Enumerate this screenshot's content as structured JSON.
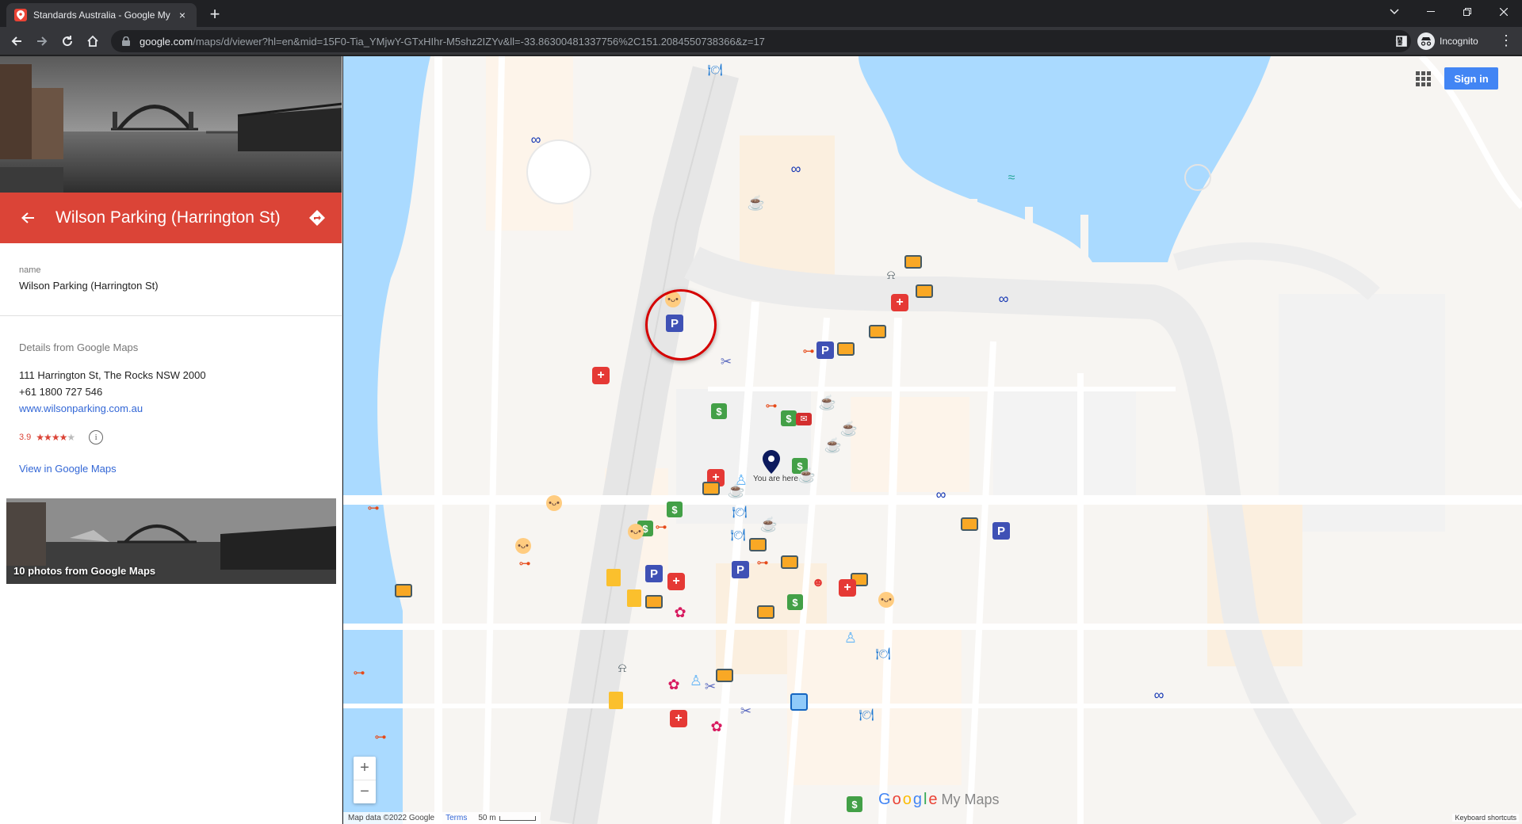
{
  "browser": {
    "tab_title": "Standards Australia - Google My",
    "tab_close": "×",
    "new_tab": "+",
    "url_host": "google.com",
    "url_path": "/maps/d/viewer?hl=en&mid=15F0-Tia_YMjwY-GTxHIhr-M5shz2IZYv&ll=-33.86300481337756%2C151.2084550738366&z=17",
    "profile_label": "Incognito",
    "menu": "⋮"
  },
  "panel": {
    "title": "Wilson Parking (Harrington St)",
    "name_key": "name",
    "name_value": "Wilson Parking (Harrington St)",
    "details_heading": "Details from Google Maps",
    "address": "111 Harrington St, The Rocks NSW 2000",
    "phone": "+61 1800 727 546",
    "website": "www.wilsonparking.com.au",
    "rating": "3.9",
    "rating_value": 3.9,
    "rating_max": 5,
    "view_link": "View in Google Maps",
    "photos_label": "10 photos from Google Maps",
    "accent_color": "#db4437"
  },
  "map": {
    "signin_label": "Sign in",
    "you_are_here": "You are here",
    "zoom_in": "+",
    "zoom_out": "−",
    "logo_google": [
      "G",
      "o",
      "o",
      "g",
      "l",
      "e"
    ],
    "logo_suffix": "My Maps",
    "attribution": "Map data ©2022 Google",
    "terms": "Terms",
    "scale_label": "50 m",
    "keyboard_shortcuts": "Keyboard shortcuts",
    "selected_marker": "P"
  },
  "icons": {
    "binoculars": "∞",
    "restaurant": "🍽",
    "gym": "⊶",
    "cafe": "☕",
    "medical": "+",
    "parking": "P",
    "cash": "$",
    "flower": "✿",
    "tooth": "♙",
    "scissors": "✂",
    "tram": "⍾",
    "mail": "✉",
    "baby": "•ᴗ•",
    "swim": "≈",
    "head": "☻"
  }
}
